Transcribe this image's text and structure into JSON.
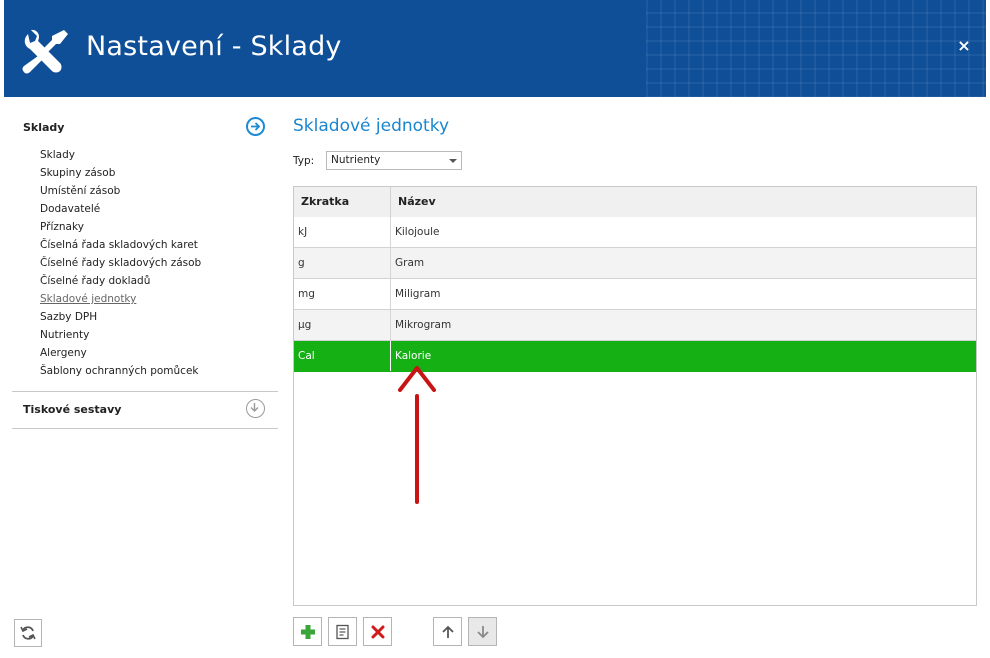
{
  "window": {
    "title": "Nastavení - Sklady",
    "close_glyph": "×"
  },
  "sidebar": {
    "sections": [
      {
        "label": "Sklady",
        "icon": "arrow-right-circle-icon",
        "expanded": true
      },
      {
        "label": "Tiskové sestavy",
        "icon": "arrow-down-circle-icon",
        "expanded": false
      }
    ],
    "items": [
      {
        "label": "Sklady"
      },
      {
        "label": "Skupiny zásob"
      },
      {
        "label": "Umístění zásob"
      },
      {
        "label": "Dodavatelé"
      },
      {
        "label": "Příznaky"
      },
      {
        "label": "Číselná řada skladových karet"
      },
      {
        "label": "Číselné řady skladových zásob"
      },
      {
        "label": "Číselné řady dokladů"
      },
      {
        "label": "Skladové jednotky",
        "active": true
      },
      {
        "label": "Sazby DPH"
      },
      {
        "label": "Nutrienty"
      },
      {
        "label": "Alergeny"
      },
      {
        "label": "Šablony ochranných pomůcek"
      }
    ]
  },
  "main": {
    "title": "Skladové jednotky",
    "filter": {
      "label": "Typ:",
      "value": "Nutrienty"
    },
    "table": {
      "columns": [
        "Zkratka",
        "Název"
      ],
      "rows": [
        [
          "kJ",
          "Kilojoule"
        ],
        [
          "g",
          "Gram"
        ],
        [
          "mg",
          "Miligram"
        ],
        [
          "µg",
          "Mikrogram"
        ],
        [
          "Cal",
          "Kalorie"
        ]
      ],
      "selected_row": 4
    }
  },
  "toolbar": {
    "buttons": [
      {
        "name": "add",
        "icon": "plus-icon",
        "color": "#3aa63a"
      },
      {
        "name": "edit",
        "icon": "edit-document-icon"
      },
      {
        "name": "delete",
        "icon": "delete-x-icon",
        "color": "#d11a1a"
      },
      {
        "name": "move-up",
        "icon": "arrow-up-icon"
      },
      {
        "name": "move-down",
        "icon": "arrow-down-icon",
        "disabled": true
      }
    ]
  },
  "colors": {
    "header": "#0e4f98",
    "accent": "#1a86d0",
    "selection": "#14b014",
    "annotation_arrow": "#c81414"
  }
}
